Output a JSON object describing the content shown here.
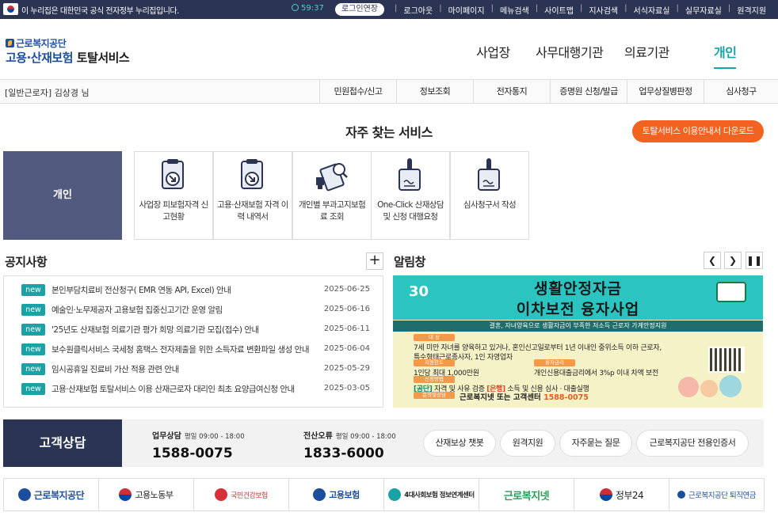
{
  "gov_bar": {
    "notice": "이 누리집은 대한민국 공식 전자정부 누리집입니다.",
    "session_timer": "59:37",
    "extend_login": "로그인연장",
    "menus": [
      "로그아웃",
      "마이페이지",
      "메뉴검색",
      "사이트맵",
      "지사검색",
      "서식자료실",
      "실무자료실",
      "원격지원"
    ]
  },
  "header": {
    "logo_org": "근로복지공단",
    "logo_service_blue": "고용·산재보험",
    "logo_service_dark": "토탈서비스",
    "nav": [
      "사업장",
      "사무대행기관",
      "의료기관",
      "개인"
    ],
    "active_nav": "개인"
  },
  "sub_bar": {
    "user_type": "[일반근로자]",
    "user_name": "김상경 님",
    "items": [
      "민원접수/신고",
      "정보조회",
      "전자통지",
      "증명원 신청/발급",
      "업무상질병판정",
      "심사청구"
    ]
  },
  "frequent": {
    "title": "자주 찾는 서비스",
    "guide_download": "토탈서비스 이용안내서 다운로드",
    "category": "개인",
    "services": [
      {
        "label": "사업장 피보험자격 신고현황",
        "icon": "document-arrow-icon"
      },
      {
        "label": "고용·산재보험 자격 이력 내역서",
        "icon": "document-arrow-icon"
      },
      {
        "label": "개인별 부과고지보험료 조회",
        "icon": "stamp-search-icon"
      },
      {
        "label": "One-Click 산재상담 및 신청 대행요청",
        "icon": "signature-doc-icon"
      },
      {
        "label": "심사청구서 작성",
        "icon": "signature-doc-icon"
      }
    ]
  },
  "notices": {
    "title": "공지사항",
    "more": "+",
    "badge": "new",
    "items": [
      {
        "title": "본인부담치료비 전산청구( EMR 연동 API, Excel) 안내",
        "date": "2025-06-25"
      },
      {
        "title": "예술인·노무제공자 고용보험 집중신고기간 운영 알림",
        "date": "2025-06-16"
      },
      {
        "title": "'25년도 산재보험 의료기관 평가 희망 의료기관 모집(접수) 안내",
        "date": "2025-06-11"
      },
      {
        "title": "보수원클릭서비스 국세청 홈택스 전자제출을 위한 소득자료 변환파일 생성 안내",
        "date": "2025-06-04"
      },
      {
        "title": "임시공휴일 진료비 가산 적용 관련 안내",
        "date": "2025-05-29"
      },
      {
        "title": "고용·산재보험 토탈서비스 이용 산재근로자 대리인 최초 요양급여신청 안내",
        "date": "2025-03-05"
      }
    ]
  },
  "alerts": {
    "title": "알림창",
    "banner": {
      "line1": "생활안정자금",
      "line2": "이차보전 융자사업",
      "desc": "결혼, 자녀양육으로 생활자금이 부족한 저소득 근로자 가계안정지원",
      "tag_target": "대 상",
      "target": "7세 미만 자녀를 양육하고 있거나, 혼인신고일로부터 1년 이내인 중위소득 이하 근로자,",
      "target2": "특수형태근로종사자, 1인 자영업자",
      "tag_limit": "지원한도",
      "limit": "1인당 최대 1,000만원",
      "tag_rate": "융자금리",
      "rate": "개인신용대출금리에서 3%p 이내 차액 보전",
      "tag_apply": "신청방법",
      "apply_a": "[공단]",
      "apply_b": " 자격 및 사유 검증 ",
      "apply_c": "[은행]",
      "apply_d": " 소득 및 신용 심사 · 대출실행",
      "tag_contact": "문의및상담",
      "contact": "근로복지넷 또는 고객센터 ",
      "contact_num": "1588-0075"
    }
  },
  "customer": {
    "title": "고객상담",
    "work_label": "업무상담",
    "work_hours": "평일 09:00 - 18:00",
    "work_number": "1588-0075",
    "error_label": "전산오류",
    "error_hours": "평일 09:00 - 18:00",
    "error_number": "1833-6000",
    "buttons": [
      "산재보상 챗봇",
      "원격지원",
      "자주묻는 질문",
      "근로복지공단 전용인증서"
    ]
  },
  "partners": [
    {
      "name": "근로복지공단",
      "color": "#1d4e9e"
    },
    {
      "name": "고용노동부",
      "color": "#0047a0"
    },
    {
      "name": "국민건강보험",
      "color": "#d6303a"
    },
    {
      "name": "고용보험",
      "color": "#1d4e9e"
    },
    {
      "name": "4대사회보험 정보연계센터",
      "color": "#1aa2a4"
    },
    {
      "name": "근로복지넷",
      "color": "#2a9d55"
    },
    {
      "name": "정부24",
      "color": "#0047a0"
    },
    {
      "name": "근로복지공단 퇴직연금",
      "color": "#1d4e9e"
    }
  ]
}
